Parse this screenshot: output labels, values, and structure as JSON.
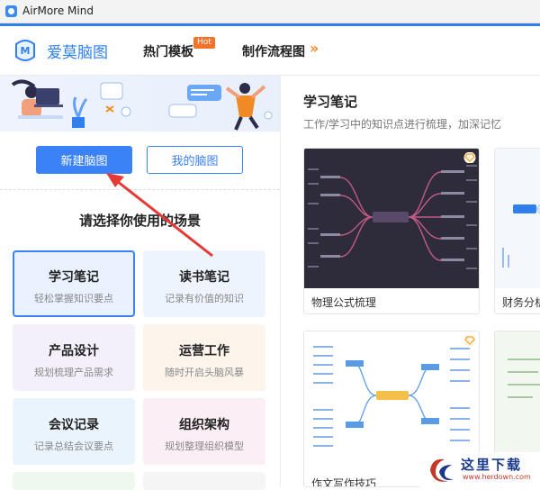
{
  "window": {
    "title": "AirMore Mind"
  },
  "header": {
    "brand": "爱莫脑图",
    "nav": [
      {
        "label": "热门模板",
        "badge": "Hot"
      },
      {
        "label": "制作流程图"
      }
    ],
    "more_icon": "double-chevron-right-icon"
  },
  "left_panel": {
    "buttons": {
      "new": "新建脑图",
      "mine": "我的脑图"
    },
    "scene_title": "请选择你使用的场景",
    "scenes": [
      {
        "title": "学习笔记",
        "subtitle": "轻松掌握知识要点",
        "selected": true,
        "color": "#eaf2ff"
      },
      {
        "title": "读书笔记",
        "subtitle": "记录有价值的知识",
        "selected": false,
        "color": "#edf4fd"
      },
      {
        "title": "产品设计",
        "subtitle": "规划梳理产品需求",
        "selected": false,
        "color": "#f3f0fb"
      },
      {
        "title": "运营工作",
        "subtitle": "随时开启头脑风暴",
        "selected": false,
        "color": "#fdf4ec"
      },
      {
        "title": "会议记录",
        "subtitle": "记录总结会议要点",
        "selected": false,
        "color": "#eaf4fd"
      },
      {
        "title": "组织架构",
        "subtitle": "规划整理组织模型",
        "selected": false,
        "color": "#fbeef4"
      }
    ]
  },
  "right_panel": {
    "title": "学习笔记",
    "subtitle": "工作/学习中的知识点进行梳理，加深记忆",
    "templates": [
      {
        "label": "物理公式梳理",
        "theme": "dark"
      },
      {
        "label": "财务分析",
        "theme": "light"
      },
      {
        "label": "作文写作技巧",
        "theme": "light"
      },
      {
        "label": "",
        "theme": "light"
      }
    ],
    "premium_icon": "diamond-icon"
  },
  "watermark": {
    "text": "这里下载",
    "url": "www.herdown.com"
  },
  "colors": {
    "accent": "#2f80ed",
    "hot": "#f5722a",
    "arrow": "#e53935"
  }
}
